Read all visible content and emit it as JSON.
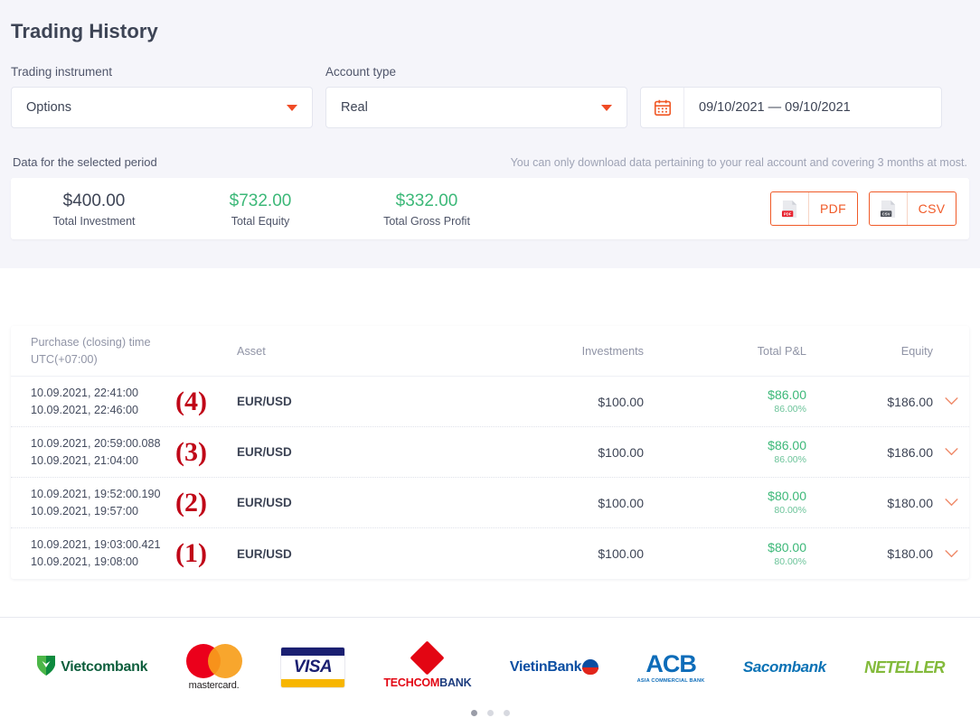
{
  "page": {
    "title": "Trading History"
  },
  "filters": {
    "instrument": {
      "label": "Trading instrument",
      "value": "Options",
      "icon": "caret-down-icon"
    },
    "account": {
      "label": "Account type",
      "value": "Real",
      "icon": "caret-down-icon"
    },
    "date_range": {
      "value": "09/10/2021 — 09/10/2021",
      "icon": "calendar-icon"
    }
  },
  "period": {
    "label": "Data for the selected period",
    "note": "You can only download data pertaining to your real account and covering 3 months at most."
  },
  "summary": {
    "stats": [
      {
        "amount": "$400.00",
        "caption": "Total Investment",
        "tone": "neutral"
      },
      {
        "amount": "$732.00",
        "caption": "Total Equity",
        "tone": "positive"
      },
      {
        "amount": "$332.00",
        "caption": "Total Gross Profit",
        "tone": "positive"
      }
    ],
    "downloads": [
      {
        "label": "PDF",
        "icon": "pdf-file-icon",
        "badge": "PDF"
      },
      {
        "label": "CSV",
        "icon": "csv-file-icon",
        "badge": "CSV"
      }
    ]
  },
  "table": {
    "headers": {
      "time_line1": "Purchase (closing) time",
      "time_line2": "UTC(+07:00)",
      "asset": "Asset",
      "investments": "Investments",
      "pl": "Total P&L",
      "equity": "Equity"
    },
    "rows": [
      {
        "open_time": "10.09.2021, 22:41:00",
        "close_time": "10.09.2021, 22:46:00",
        "annotation": "(4)",
        "asset": "EUR/USD",
        "investment": "$100.00",
        "pl_amount": "$86.00",
        "pl_percent": "86.00%",
        "equity": "$186.00",
        "expand_icon": "chevron-down-icon"
      },
      {
        "open_time": "10.09.2021, 20:59:00.088",
        "close_time": "10.09.2021, 21:04:00",
        "annotation": "(3)",
        "asset": "EUR/USD",
        "investment": "$100.00",
        "pl_amount": "$86.00",
        "pl_percent": "86.00%",
        "equity": "$186.00",
        "expand_icon": "chevron-down-icon"
      },
      {
        "open_time": "10.09.2021, 19:52:00.190",
        "close_time": "10.09.2021, 19:57:00",
        "annotation": "(2)",
        "asset": "EUR/USD",
        "investment": "$100.00",
        "pl_amount": "$80.00",
        "pl_percent": "80.00%",
        "equity": "$180.00",
        "expand_icon": "chevron-down-icon"
      },
      {
        "open_time": "10.09.2021, 19:03:00.421",
        "close_time": "10.09.2021, 19:08:00",
        "annotation": "(1)",
        "asset": "EUR/USD",
        "investment": "$100.00",
        "pl_amount": "$80.00",
        "pl_percent": "80.00%",
        "equity": "$180.00",
        "expand_icon": "chevron-down-icon"
      }
    ]
  },
  "footer": {
    "logos": [
      {
        "name": "vietcombank",
        "text": "Vietcombank"
      },
      {
        "name": "mastercard",
        "text": "mastercard."
      },
      {
        "name": "visa",
        "text": "VISA"
      },
      {
        "name": "techcombank",
        "text_a": "TECHCOM",
        "text_b": "BANK"
      },
      {
        "name": "vietinbank",
        "text": "VietinBank"
      },
      {
        "name": "acb",
        "text": "ACB",
        "sub": "ASIA COMMERCIAL BANK"
      },
      {
        "name": "sacombank",
        "text": "Sacombank"
      },
      {
        "name": "neteller",
        "text": "NETELLER"
      }
    ],
    "carousel": {
      "total": 3,
      "active": 1
    }
  },
  "colors": {
    "accent_orange": "#f05a28",
    "positive_green": "#3cb878",
    "annotation_red": "#c00718",
    "section_bg": "#f5f5fa"
  }
}
